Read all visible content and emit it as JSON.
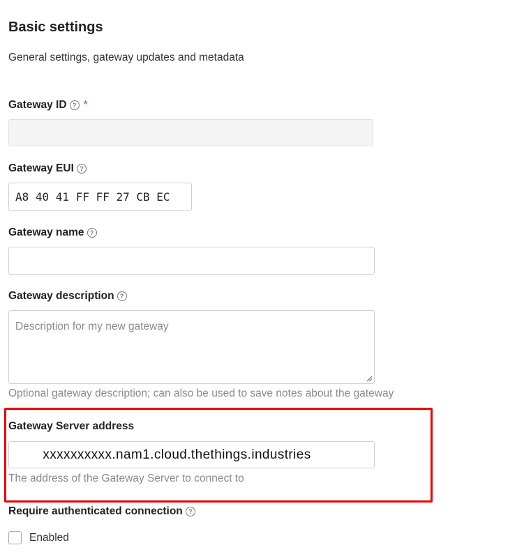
{
  "header": {
    "title": "Basic settings",
    "subtitle": "General settings, gateway updates and metadata"
  },
  "fields": {
    "gateway_id": {
      "label": "Gateway ID",
      "required_mark": "*",
      "value": ""
    },
    "gateway_eui": {
      "label": "Gateway EUI",
      "value": "A8 40 41 FF FF 27 CB EC"
    },
    "gateway_name": {
      "label": "Gateway name",
      "value": ""
    },
    "gateway_description": {
      "label": "Gateway description",
      "placeholder": "Description for my new gateway",
      "hint": "Optional gateway description; can also be used to save notes about the gateway"
    },
    "gateway_server_address": {
      "label": "Gateway Server address",
      "value": "xxxxxxxxxx.nam1.cloud.thethings.industries",
      "hint": "The address of the Gateway Server to connect to"
    },
    "require_authenticated_connection": {
      "label": "Require authenticated connection",
      "checkbox_label": "Enabled",
      "checked": false
    }
  },
  "icons": {
    "help": "help-circle-icon",
    "help_glyph": "?"
  },
  "colors": {
    "highlight": "#ee0000",
    "required": "#dd3333",
    "hint_text": "#8a8a8a"
  }
}
